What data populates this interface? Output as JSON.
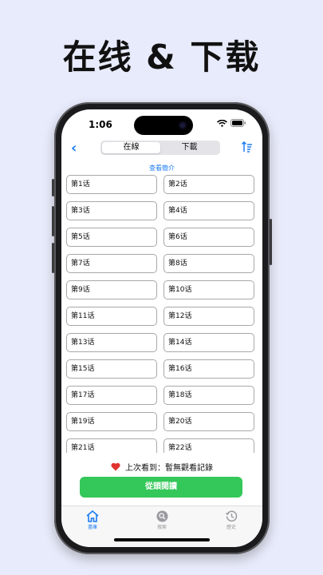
{
  "headline": "在线 & 下载",
  "status": {
    "time": "1:06"
  },
  "nav": {
    "tabs": [
      "在線",
      "下載"
    ],
    "selected_tab": "在線"
  },
  "intro_link": "查看簡介",
  "episodes": [
    "第1话",
    "第2话",
    "第3话",
    "第4话",
    "第5话",
    "第6话",
    "第7话",
    "第8话",
    "第9话",
    "第10话",
    "第11话",
    "第12话",
    "第13话",
    "第14话",
    "第15话",
    "第16话",
    "第17话",
    "第18话",
    "第19话",
    "第20话",
    "第21话",
    "第22话"
  ],
  "last_read": {
    "label": "上次看到：暫無觀看記錄"
  },
  "read_button": "從頭閱讀",
  "tabbar": {
    "items": [
      "書庫",
      "搜索",
      "歷史"
    ],
    "active": "書庫"
  },
  "colors": {
    "accent": "#1a7cf2",
    "primary_button": "#34c759",
    "heart": "#e0342f",
    "background": "#e8ebfb"
  }
}
